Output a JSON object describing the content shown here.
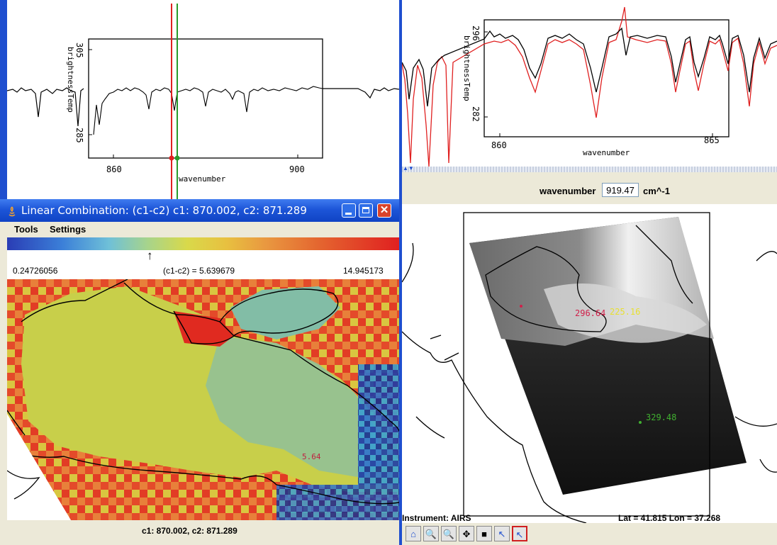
{
  "top_left_plot": {
    "ylabel": "brightnessTemp",
    "xlabel": "wavenumber",
    "y_ticks": [
      "305",
      "285"
    ],
    "x_ticks": [
      "860",
      "900"
    ]
  },
  "top_right_plot": {
    "ylabel": "brightnessTemp",
    "xlabel": "wavenumber",
    "y_ticks": [
      "296",
      "282"
    ],
    "x_ticks": [
      "860",
      "865"
    ]
  },
  "window": {
    "title": "Linear Combination: (c1-c2)  c1: 870.002,  c2: 871.289",
    "menu": [
      "Tools",
      "Settings"
    ],
    "colorbar": {
      "min": "0.24726056",
      "center": "(c1-c2) = 5.639679",
      "max": "14.945173",
      "arrow": "↑"
    },
    "probe_value": "5.64",
    "footer": "c1: 870.002,  c2: 871.289"
  },
  "right_panel": {
    "wavenumber_label": "wavenumber",
    "wavenumber_value": "919.47",
    "wavenumber_unit": "cm^-1",
    "probe_red": "296.64",
    "probe_yellow": "225.16",
    "probe_green": "329.48",
    "instrument": "Instrument: AIRS",
    "coords": "Lat = 41.815   Lon = 37.268"
  },
  "colors": {
    "titlebar": "#1d55d8",
    "cursor_red": "#e02020",
    "cursor_green": "#2a9a2a",
    "probe_red": "#d0204a",
    "probe_yellow": "#e8e030",
    "probe_green": "#40b030"
  },
  "toolbar_icons": [
    "home-icon",
    "zoom-in-icon",
    "zoom-out-icon",
    "pan-icon",
    "box-select-icon",
    "pointer-icon",
    "pointer-selected-icon"
  ]
}
